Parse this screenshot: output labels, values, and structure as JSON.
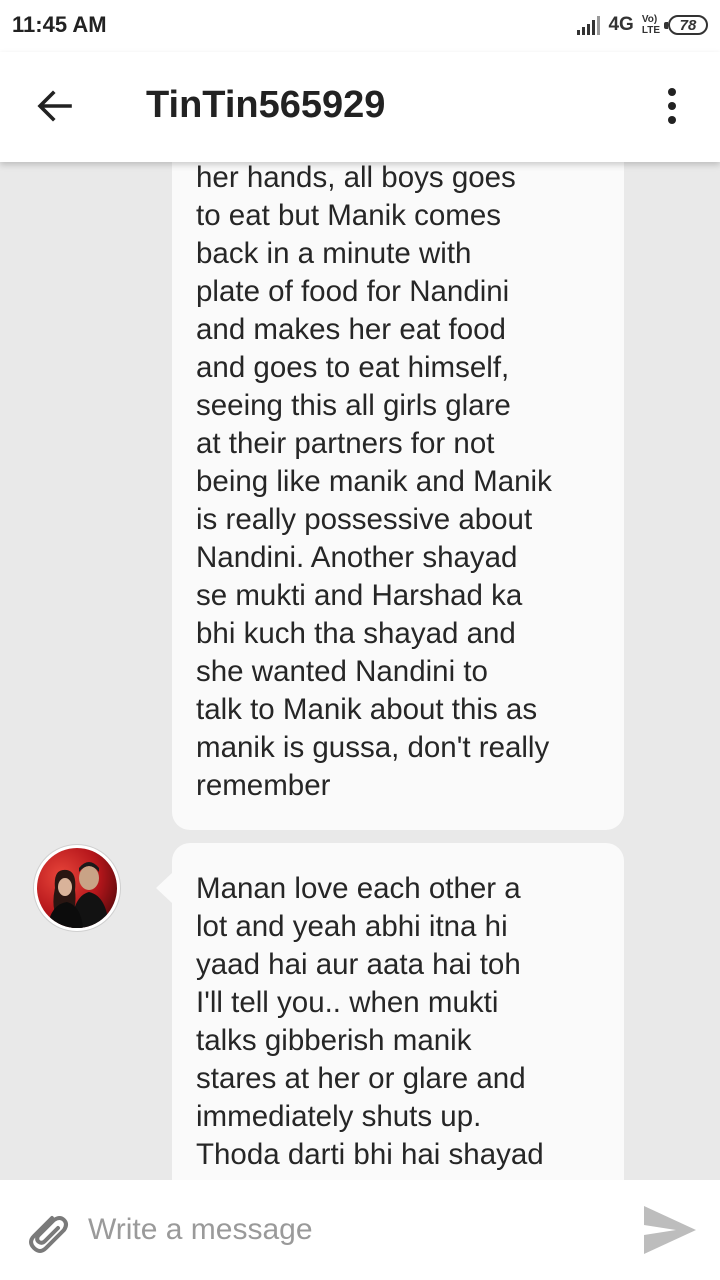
{
  "status_bar": {
    "time": "11:45 AM",
    "network": "4G",
    "volte_top": "Vo)",
    "volte_bottom": "LTE",
    "battery": "78"
  },
  "header": {
    "title": "TinTin565929",
    "back_icon": "arrow-left-icon",
    "menu_icon": "more-vert-icon"
  },
  "messages": [
    {
      "text": "her hands, all boys goes\nto eat but Manik comes\nback in a minute with\nplate of food for Nandini\nand makes her eat food\nand goes to eat himself,\nseeing this all girls glare\nat their partners for not\nbeing like manik and Manik\nis really possessive about\nNandini. Another shayad\nse mukti and Harshad ka\nbhi kuch tha shayad and\nshe wanted Nandini to\ntalk to Manik about this as\nmanik is gussa, don't really\nremember"
    },
    {
      "text": "Manan love each other a\nlot and yeah abhi itna hi\nyaad hai aur aata hai toh\nI'll tell you.. when mukti\ntalks gibberish manik\nstares at her or glare and\nimmediately shuts up.\nThoda darti bhi hai shayad"
    }
  ],
  "composer": {
    "placeholder": "Write a message",
    "attach_icon": "paperclip-icon",
    "send_icon": "send-icon"
  },
  "colors": {
    "background": "#e9e9e9",
    "bubble": "#fafafa",
    "text": "#262626",
    "send_icon": "#bdbdbd"
  }
}
